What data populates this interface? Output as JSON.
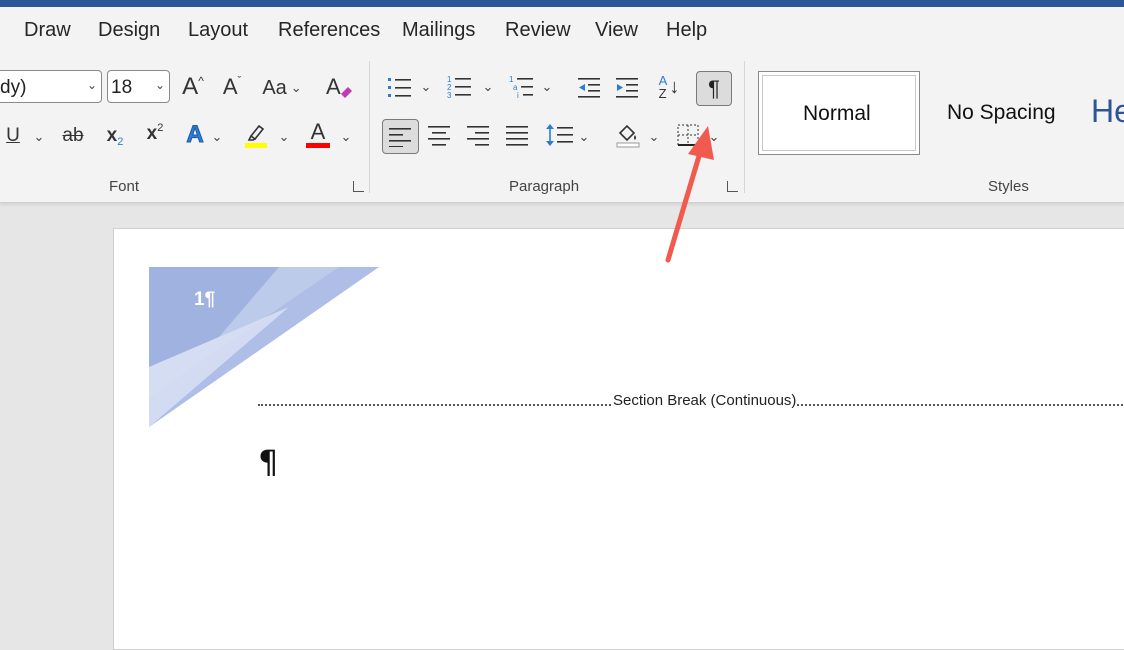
{
  "tabs": [
    "Draw",
    "Design",
    "Layout",
    "References",
    "Mailings",
    "Review",
    "View",
    "Help"
  ],
  "font": {
    "name_value": "dy)",
    "size_value": "18",
    "grow_icon_text": "A",
    "shrink_icon_text": "A",
    "case_label": "Aa",
    "group_label": "Font",
    "underline_label": "U",
    "strike_label": "ab",
    "subscript_label": "x",
    "superscript_label": "x",
    "effects_label": "A",
    "highlight_color": "#ffff00",
    "font_color": "#ff0000",
    "font_color_label": "A"
  },
  "paragraph": {
    "group_label": "Paragraph",
    "sort_label_a": "A",
    "sort_label_z": "Z",
    "show_marks_label": "¶"
  },
  "styles": {
    "group_label": "Styles",
    "items": [
      "Normal",
      "No Spacing",
      "He"
    ]
  },
  "document": {
    "header_number": "1¶",
    "section_break": "Section Break (Continuous)",
    "paragraph_mark": "¶"
  },
  "colors": {
    "accent": "#2b579a",
    "arrow": "#f05a4f"
  }
}
